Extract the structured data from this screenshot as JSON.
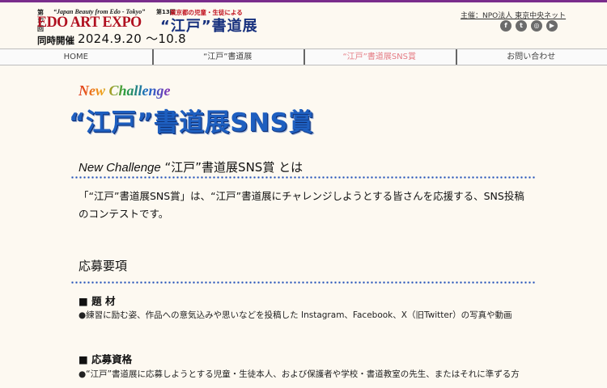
{
  "header": {
    "edo": {
      "edition": "第17回",
      "tagline": "“Japan Beauty from Edo - Tokyo”",
      "title": "EDO ART EXPO"
    },
    "shodo": {
      "edition": "第13回",
      "subtitle": "東京都の児童・生徒による",
      "title": "“江戸”書道展"
    },
    "concurrent_label": "同時開催",
    "dates": "2024.9.20 〜10.8",
    "organizer": "主催：NPO法人 東京中央ネット",
    "social": [
      "facebook-icon",
      "twitter-icon",
      "instagram-icon",
      "youtube-icon"
    ]
  },
  "nav": {
    "items": [
      "HOME",
      "“江戸”書道展",
      "“江戸”書道展SNS賞",
      "お問い合わせ"
    ],
    "active_color": "#e57c84"
  },
  "hero": {
    "new_challenge": "New Challenge",
    "title": "“江戸”書道展SNS賞"
  },
  "about": {
    "heading_italic": "New Challenge",
    "heading_rest": "“江戸”書道展SNS賞 とは",
    "text": "「“江戸”書道展SNS賞」は、“江戸”書道展にチャレンジしようとする皆さんを応援する、SNS投稿のコンテストです。"
  },
  "requirements": {
    "heading": "応募要項",
    "theme_heading": "■ 題 材",
    "theme_text": "●練習に励む姿、作品への意気込みや思いなどを投稿した Instagram、Facebook、X（旧Twitter）の写真や動画",
    "eligibility_heading": "■ 応募資格",
    "eligibility_text": "●“江戸”書道展に応募しようとする児童・生徒本人、および保護者や学校・書道教室の先生、またはそれに準ずる方"
  },
  "colors": {
    "purple_bar": "#7a2d8c",
    "brand_blue": "#1e5fc0",
    "dot_blue": "#1f4fb8",
    "edo_red": "#b01020"
  }
}
